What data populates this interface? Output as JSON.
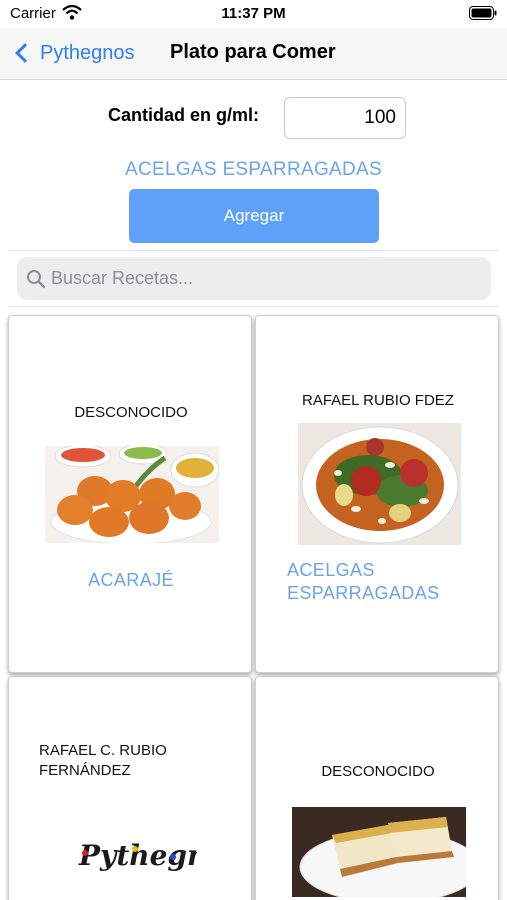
{
  "status_bar": {
    "carrier": "Carrier",
    "time": "11:37 PM"
  },
  "nav": {
    "back_label": "Pythegnos",
    "title": "Plato para Comer"
  },
  "quantity": {
    "label": "Cantidad en g/ml:",
    "value": "100"
  },
  "selected": {
    "recipe": "ACELGAS ESPARRAGADAS",
    "add_label": "Agregar"
  },
  "search": {
    "placeholder": "Buscar Recetas..."
  },
  "recipes": [
    {
      "author": "DESCONOCIDO",
      "title": "ACARAJÉ",
      "image": "fried-fritters-photo"
    },
    {
      "author": "RAFAEL RUBIO FDEZ",
      "title": "ACELGAS ESPARRAGADAS",
      "image": "chard-stew-photo"
    },
    {
      "author": "RAFAEL C. RUBIO FERNÁNDEZ",
      "title": "",
      "image": "pythegnos-logo",
      "logo_text": "Pythegnos"
    },
    {
      "author": "DESCONOCIDO",
      "title": "",
      "image": "cake-slices-photo"
    }
  ],
  "colors": {
    "accent": "#2f7cf6",
    "button": "#5fa1f8",
    "link": "#6aa3ee"
  }
}
